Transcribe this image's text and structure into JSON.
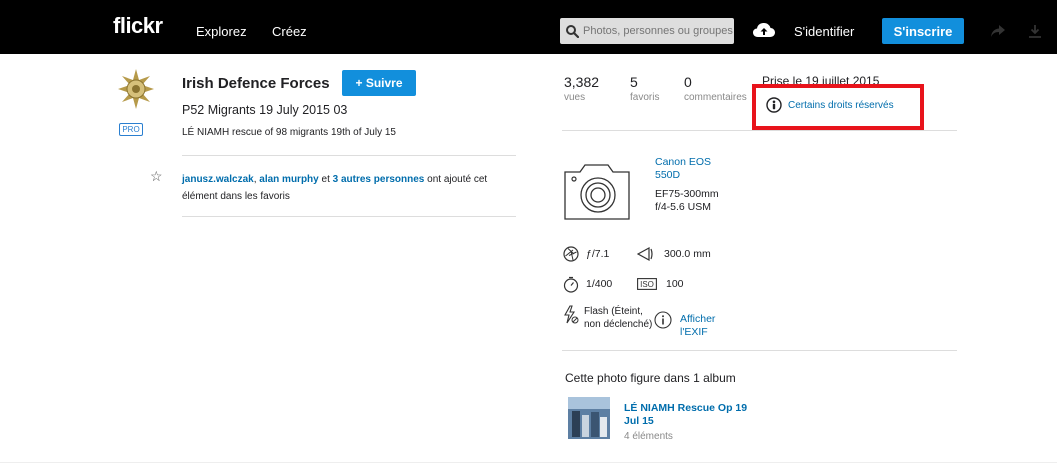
{
  "header": {
    "logo": "flickr",
    "nav": [
      "Explorez",
      "Créez"
    ],
    "search_placeholder": "Photos, personnes ou groupes",
    "signin": "S'identifier",
    "signup": "S'inscrire"
  },
  "owner": {
    "name": "Irish Defence Forces",
    "follow_label": "+ Suivre",
    "pro_badge": "PRO"
  },
  "photo": {
    "title": "P52 Migrants 19 July 2015 03",
    "description": "LÉ NIAMH rescue of 98 migrants 19th of July 15"
  },
  "faves": {
    "user1": "janusz.walczak",
    "sep1": ", ",
    "user2": "alan murphy",
    "sep2": " et ",
    "others": "3 autres personnes",
    "suffix": " ont ajouté cet élément dans les favoris"
  },
  "stats": [
    {
      "value": "3,382",
      "label": "vues"
    },
    {
      "value": "5",
      "label": "favoris"
    },
    {
      "value": "0",
      "label": "commentaires"
    }
  ],
  "taken": "Prise le 19 juillet 2015",
  "license": "Certains droits réservés",
  "camera": {
    "model": "Canon EOS 550D",
    "lens": "EF75-300mm f/4-5.6 USM"
  },
  "exif": {
    "aperture": "ƒ/7.1",
    "focal": "300.0 mm",
    "shutter": "1/400",
    "iso": "100",
    "flash": "Flash (Éteint, non déclenché)",
    "show_exif": "Afficher l'EXIF"
  },
  "album": {
    "heading": "Cette photo figure dans 1 album",
    "name": "LÉ NIAMH Rescue Op 19 Jul 15",
    "count": "4 éléments"
  },
  "colors": {
    "accent": "#128fdc",
    "link": "#006dac",
    "highlight": "#e8131b"
  }
}
